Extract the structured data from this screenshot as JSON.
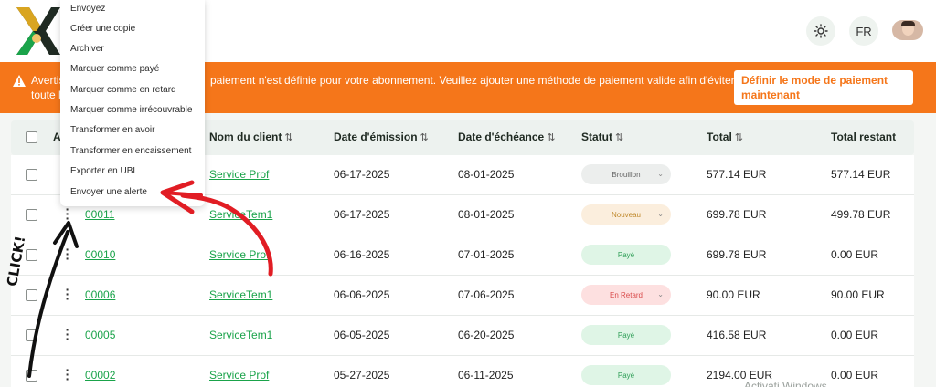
{
  "header": {
    "theme_icon": "sun-icon",
    "lang_label": "FR",
    "avatar_icon": "user-avatar"
  },
  "banner": {
    "text_start": "Avertis",
    "text_middle": "paiement n'est définie pour votre abonnement. Veuillez ajouter une méthode de paiement valide afin d'éviter",
    "text_line2": "toute l",
    "button_label": "Définir le mode de paiement maintenant",
    "warn_icon": "warning-icon",
    "color": "#f5761a"
  },
  "table": {
    "headers": {
      "actions": "Ac",
      "client": "Nom du client",
      "issue_date": "Date d'émission",
      "due_date": "Date d'échéance",
      "status": "Statut",
      "total": "Total",
      "remaining": "Total restant"
    },
    "sort_glyph": "⇅",
    "rows": [
      {
        "id": "",
        "client": "Service Prof",
        "issue": "06-17-2025",
        "due": "08-01-2025",
        "status": "Brouillon",
        "total": "577.14 EUR",
        "remaining": "577.14 EUR"
      },
      {
        "id": "00011",
        "client": "ServiceTem1",
        "issue": "06-17-2025",
        "due": "08-01-2025",
        "status": "Nouveau",
        "total": "699.78 EUR",
        "remaining": "499.78 EUR"
      },
      {
        "id": "00010",
        "client": "Service Prof",
        "issue": "06-16-2025",
        "due": "07-01-2025",
        "status": "Payé",
        "total": "699.78 EUR",
        "remaining": "0.00 EUR"
      },
      {
        "id": "00006",
        "client": "ServiceTem1",
        "issue": "06-06-2025",
        "due": "07-06-2025",
        "status": "En Retard",
        "total": "90.00 EUR",
        "remaining": "90.00 EUR"
      },
      {
        "id": "00005",
        "client": "ServiceTem1",
        "issue": "06-05-2025",
        "due": "06-20-2025",
        "status": "Payé",
        "total": "416.58 EUR",
        "remaining": "0.00 EUR"
      },
      {
        "id": "00002",
        "client": "Service Prof",
        "issue": "05-27-2025",
        "due": "06-11-2025",
        "status": "Payé",
        "total": "2194.00 EUR",
        "remaining": "0.00 EUR"
      }
    ]
  },
  "menu": {
    "items": [
      "Envoyez",
      "Créer une copie",
      "Archiver",
      "Marquer comme payé",
      "Marquer comme en retard",
      "Marquer comme irrécouvrable",
      "Transformer en avoir",
      "Transformer en encaissement",
      "Exporter en UBL",
      "Envoyer une alerte"
    ]
  },
  "annotation": {
    "click_text": "CLICK!",
    "arrow_color": "#e11d24"
  },
  "watermark": "Activati Windows",
  "status_colors": {
    "Brouillon": {
      "bg": "#eceeed",
      "fg": "#666666"
    },
    "Nouveau": {
      "bg": "#fbeedd",
      "fg": "#c08a2e"
    },
    "Payé": {
      "bg": "#dff5e6",
      "fg": "#2e9e57"
    },
    "En Retard": {
      "bg": "#fde0e0",
      "fg": "#d94b4b"
    }
  }
}
